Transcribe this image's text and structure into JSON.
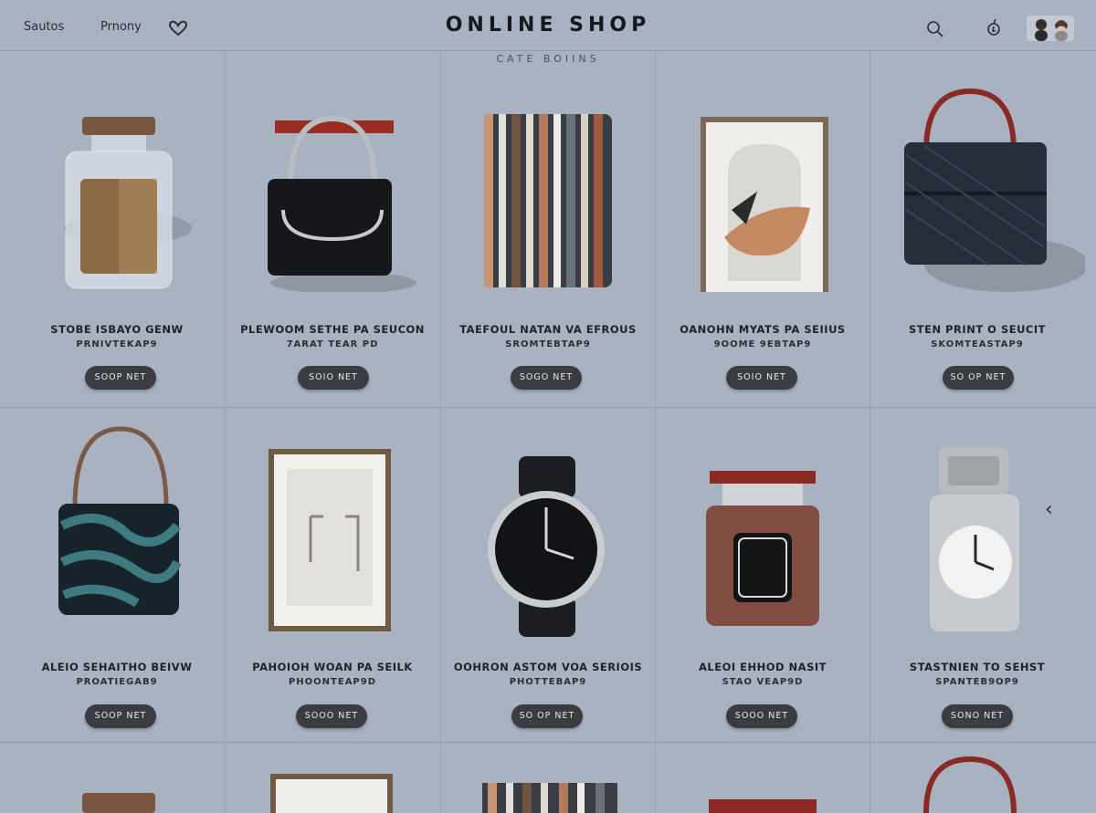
{
  "header": {
    "brand": "ONLINE SHOP",
    "nav": [
      {
        "label": "Sautos"
      },
      {
        "label": "Prnony"
      }
    ],
    "subnav": "CATE BOIINS",
    "icons": [
      "heart-icon",
      "search-icon",
      "notification-icon",
      "avatar-icon"
    ]
  },
  "products": [
    {
      "name": "STOBE ISBAYO GENW",
      "price": "PRNIVTEKAP9",
      "button": "SOOP NET",
      "icon": "perfume-jar"
    },
    {
      "name": "PLEWOOM SETHE PA SEUCON",
      "price": "7ARAT TEAR PD",
      "button": "SOIO NET",
      "icon": "black-handbag"
    },
    {
      "name": "TAEFOUL NATAN VA EFROUS",
      "price": "SROMTEBTAP9",
      "button": "SOGO NET",
      "icon": "striped-pouch"
    },
    {
      "name": "OANOHN MYATS PA SEIIUS",
      "price": "9OOME 9EBTAP9",
      "button": "SOIO NET",
      "icon": "framed-art"
    },
    {
      "name": "STEN PRINT O SEUCIT",
      "price": "SKOMTEASTAP9",
      "button": "SO OP NET",
      "icon": "navy-handbag"
    },
    {
      "name": "ALEIO SEHAITHO BEIVW",
      "price": "PROATIEGAB9",
      "button": "SOOP NET",
      "icon": "teal-handbag"
    },
    {
      "name": "PAHOIOH WOAN PA SEILK",
      "price": "PHOONTEAP9D",
      "button": "SOOO NET",
      "icon": "framed-hooks"
    },
    {
      "name": "OOHRON ASTOM VOA SERIOIS",
      "price": "PHOTTEBAP9",
      "button": "SO OP NET",
      "icon": "wrist-watch"
    },
    {
      "name": "ALEOI EHHOD NASIT",
      "price": "STAO VEAP9D",
      "button": "SOOO NET",
      "icon": "glass-jar"
    },
    {
      "name": "STASTNIEN TO SEHST",
      "price": "SPANTEB9OP9",
      "button": "SONO NET",
      "icon": "silver-clock"
    }
  ],
  "colors": {
    "background": "#a9b2c1",
    "button": "#3a3c41",
    "text": "#1f232a"
  }
}
